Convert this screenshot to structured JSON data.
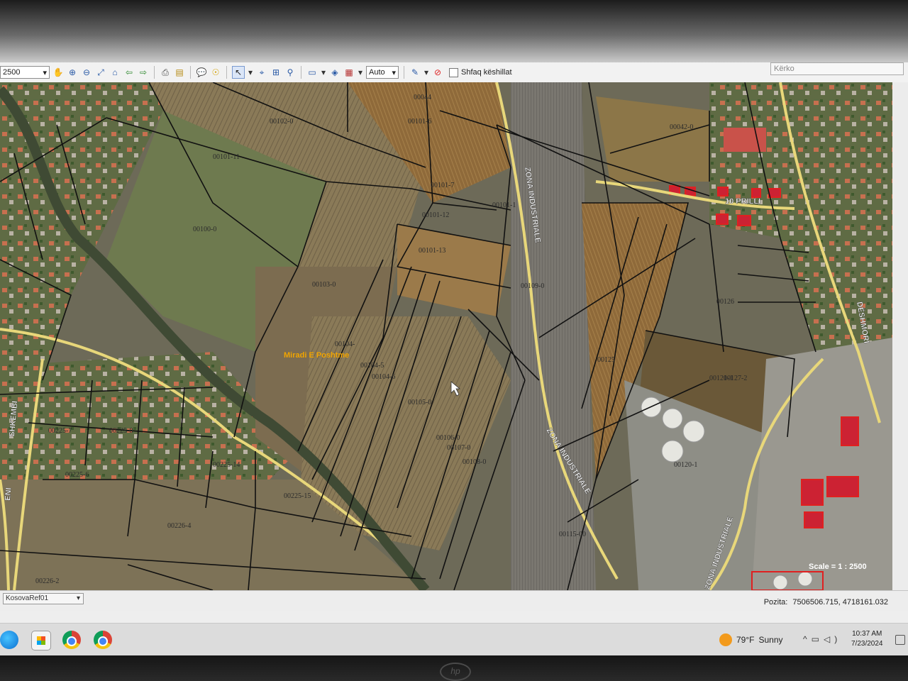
{
  "toolbar": {
    "scale_value": "2500",
    "zoom_mode": "Auto",
    "show_tips_label": "Shfaq këshillat",
    "search_placeholder": "Kërko",
    "icons": [
      "hand-icon",
      "zoom-in-icon",
      "zoom-out-icon",
      "zoom-extent-icon",
      "home-icon",
      "back-icon",
      "forward-icon",
      "print-icon",
      "export-icon",
      "comment-icon",
      "identify-icon",
      "select-arrow-icon",
      "measure-icon",
      "pan-select-icon",
      "info-icon",
      "ruler-icon",
      "layers-icon",
      "table-icon",
      "pencil-icon",
      "stop-icon"
    ]
  },
  "map": {
    "parcel_labels": [
      "00102-0",
      "00101-6",
      "00044",
      "00101-11",
      "00101-7",
      "00101-12",
      "00100-0",
      "00101-13",
      "00103-0",
      "00104-",
      "00104-5",
      "00104-6",
      "00105-0",
      "00106-0",
      "00107-0",
      "00108-0",
      "00101-1",
      "00109-0",
      "00225-7",
      "00225-8",
      "00225-6",
      "00225-14",
      "00225-15",
      "00226-4",
      "00226-2",
      "00121-1",
      "00120-1",
      "00115-00",
      "00125",
      "00127-2",
      "00126",
      "00042-0"
    ],
    "place_label": "Miradi E Poshtme",
    "road_labels": {
      "zona_1": "ZONA INDUSTRIALE",
      "zona_2": "ZONA INDUSTRIALE",
      "zona_3": "ZONA INDUSTRIALE",
      "prilli": "10 PRILLI",
      "deshmori": "DËSHMORI",
      "shkembi": "SHKEMBI",
      "eni": "ENI"
    },
    "scale_text": "Scale = 1 : 2500"
  },
  "status": {
    "layer": "KosovaRef01",
    "pozita_label": "Pozita:",
    "pozita_value": "7506506.715, 4718161.032"
  },
  "taskbar": {
    "icons": [
      "edge-icon",
      "store-icon",
      "chrome-icon",
      "chrome-icon-2"
    ],
    "weather_temp": "79°F",
    "weather_text": "Sunny",
    "time": "10:37 AM",
    "date": "7/23/2024",
    "brand": "hp"
  },
  "colors": {
    "road": "#e8d77a",
    "parcel_line": "#111111",
    "field_light": "#8c7a5e",
    "field_green": "#4f6a3a"
  }
}
